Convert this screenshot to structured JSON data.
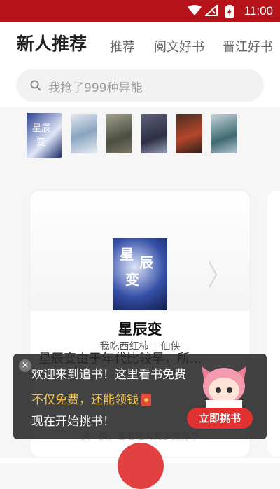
{
  "status_bar": {
    "time": "11:00"
  },
  "header": {
    "title": "新人推荐",
    "tabs": [
      "推荐",
      "阅文好书",
      "晋江好书"
    ]
  },
  "search": {
    "placeholder": "我抢了999种异能"
  },
  "cover_strip": [
    {
      "name": "星辰变",
      "colors": [
        "#1a2a6b",
        "#e9eef8"
      ]
    },
    {
      "name": "book-2",
      "colors": [
        "#d7dde6",
        "#3e5f86"
      ]
    },
    {
      "name": "book-3",
      "colors": [
        "#8a8a82",
        "#4b4e40"
      ]
    },
    {
      "name": "book-4",
      "colors": [
        "#2e2f46",
        "#9aa0b5"
      ]
    },
    {
      "name": "book-5",
      "colors": [
        "#2b1e1a",
        "#b4472b"
      ]
    },
    {
      "name": "book-6",
      "colors": [
        "#b7c6cf",
        "#3f6a72"
      ]
    }
  ],
  "featured_book": {
    "title": "星辰变",
    "author": "我吃西红柿",
    "genre": "仙侠",
    "description": "星辰变由于年代比较早，所..."
  },
  "toast": {
    "line1": "欢迎来到追书！这里看书免费",
    "line2": "不仅免费，还能领钱",
    "line3": "现在开始挑书！",
    "cta": "立即挑书",
    "close": "×"
  },
  "footer_hint": "换一换，看看还有更多推荐书"
}
